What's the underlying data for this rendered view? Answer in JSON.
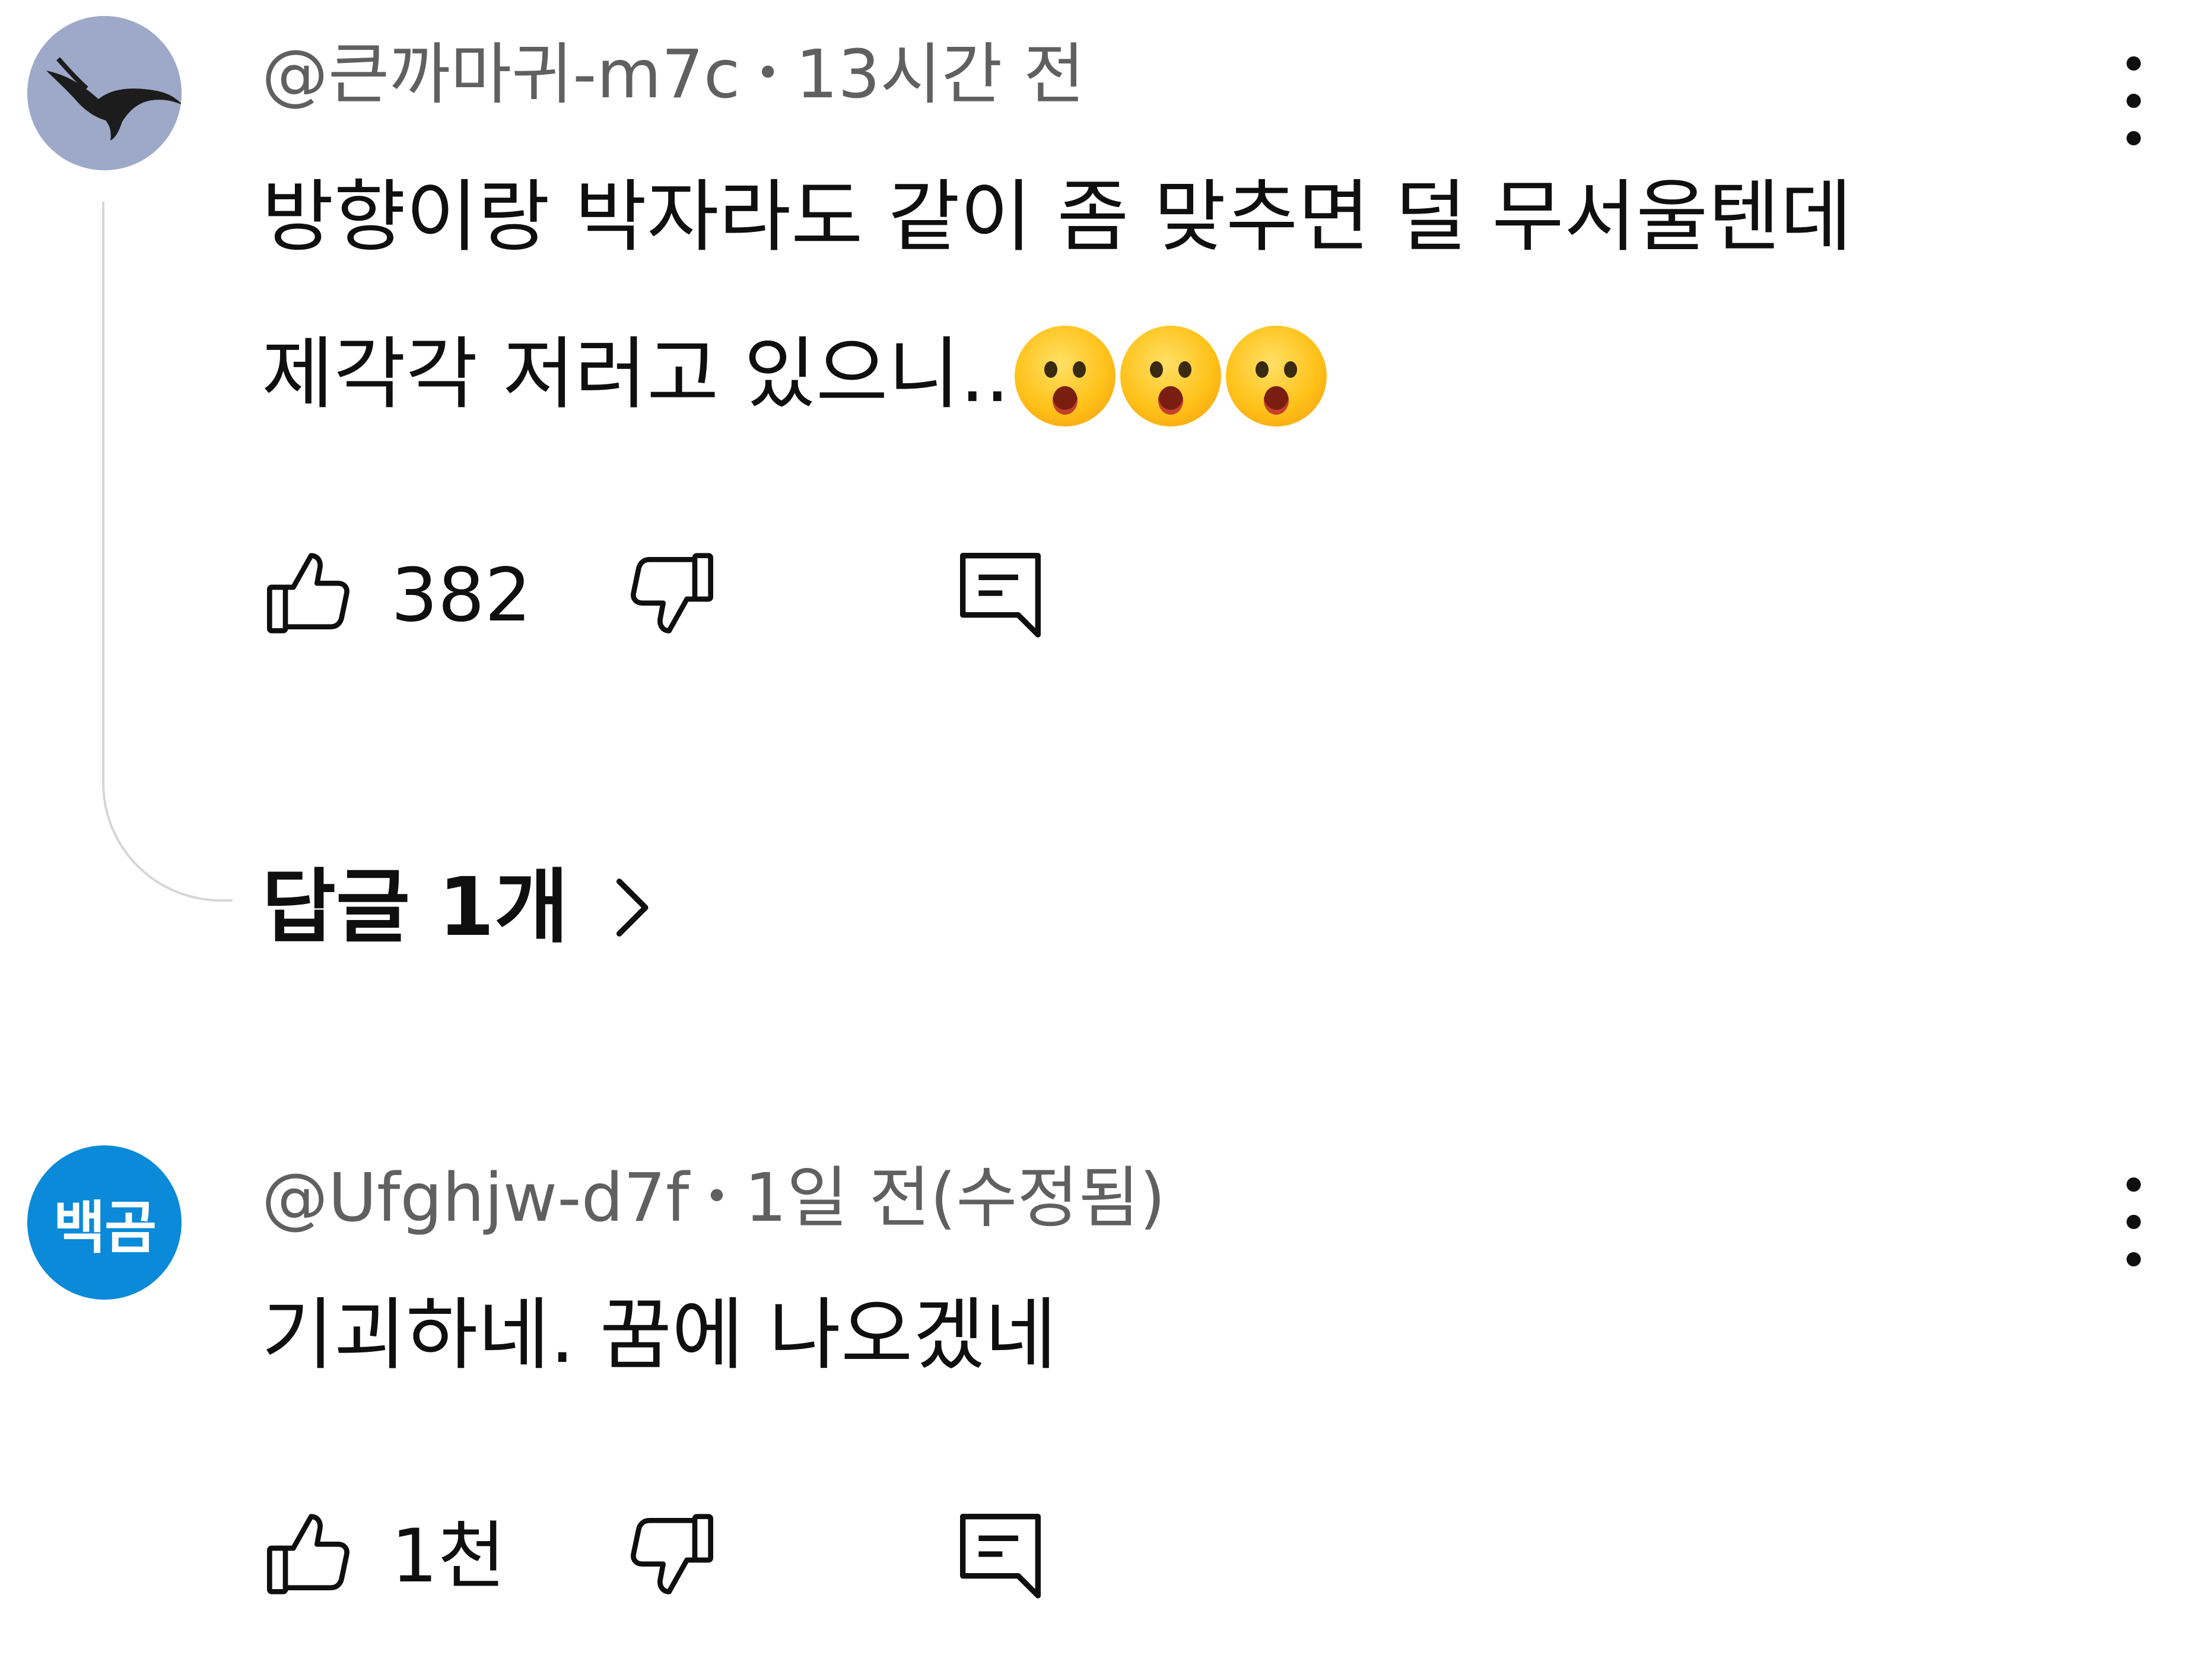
{
  "comments": [
    {
      "author": "@큰까마귀-m7c",
      "time": "13시간 전",
      "text_line1": "방향이랑 박자라도 같이 좀 맞추면 덜 무서울텐데",
      "text_line2": "제각각 저러고 있으니..",
      "emoji": [
        "astonished-face",
        "astonished-face",
        "astonished-face"
      ],
      "likes": "382",
      "replies_label": "답글 1개",
      "avatar": "crow-flying-photo"
    },
    {
      "author": "@Ufghjw-d7f",
      "time": "1일 전(수정됨)",
      "text": "기괴하네. 꿈에 나오겠네",
      "likes": "1천",
      "avatar_text": "백곰"
    }
  ],
  "colors": {
    "text": "#0f0f0f",
    "meta": "#606060",
    "avatar_blue": "#0a8ad8",
    "thread_line": "#d6d6d6"
  },
  "icons": [
    "thumb-up-icon",
    "thumb-down-icon",
    "reply-icon",
    "more-vert-icon",
    "chevron-right-icon"
  ]
}
